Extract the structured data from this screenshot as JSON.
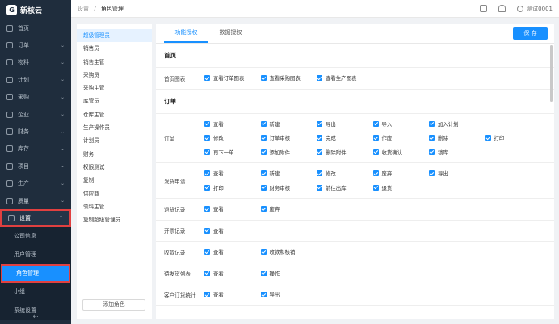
{
  "app": {
    "logo_glyph": "G",
    "name": "新核云"
  },
  "sidebar": {
    "items": [
      {
        "label": "首页",
        "icon": "home-icon",
        "has_chevron": false
      },
      {
        "label": "订单",
        "icon": "order-icon",
        "has_chevron": true
      },
      {
        "label": "物料",
        "icon": "material-icon",
        "has_chevron": true
      },
      {
        "label": "计划",
        "icon": "plan-icon",
        "has_chevron": true
      },
      {
        "label": "采购",
        "icon": "purchase-icon",
        "has_chevron": true
      },
      {
        "label": "企业",
        "icon": "company-icon",
        "has_chevron": true
      },
      {
        "label": "财务",
        "icon": "finance-icon",
        "has_chevron": true
      },
      {
        "label": "库存",
        "icon": "stock-icon",
        "has_chevron": true
      },
      {
        "label": "项目",
        "icon": "project-icon",
        "has_chevron": true
      },
      {
        "label": "生产",
        "icon": "production-icon",
        "has_chevron": true
      },
      {
        "label": "质量",
        "icon": "quality-icon",
        "has_chevron": true
      },
      {
        "label": "设置",
        "icon": "settings-icon",
        "has_chevron": true,
        "expanded": true
      }
    ],
    "submenu": [
      "公司信息",
      "用户管理",
      "角色管理",
      "小组",
      "系统设置"
    ],
    "active_sub": 2,
    "collapse_glyph": "⇠"
  },
  "header": {
    "breadcrumb_root": "设置",
    "breadcrumb_sep": "/",
    "breadcrumb_current": "角色管理",
    "user_name": "测试0001"
  },
  "roles": {
    "list": [
      "超级管理员",
      "销售员",
      "销售主管",
      "采购员",
      "采购主管",
      "库管员",
      "仓库主管",
      "生产操作员",
      "计划员",
      "财务",
      "权限测试",
      "复制",
      "供应商",
      "领料主管",
      "复制超级管理员"
    ],
    "selected": 0,
    "add_label": "添加角色"
  },
  "main": {
    "tabs": [
      "功能授权",
      "数据授权"
    ],
    "active_tab": 0,
    "save_label": "保 存",
    "sections": [
      {
        "title": "首页",
        "rows": [
          {
            "label": "首页图表",
            "lines": [
              [
                "查看订单图表",
                "查看采购图表",
                "查看生产图表"
              ]
            ]
          }
        ]
      },
      {
        "title": "订单",
        "rows": [
          {
            "label": "订单",
            "lines": [
              [
                "查看",
                "新建",
                "导出",
                "导入",
                "加入计划"
              ],
              [
                "修改",
                "订单审核",
                "完成",
                "作废",
                "删除",
                "打印"
              ],
              [
                "再下一单",
                "添加附件",
                "删除附件",
                "收货确认",
                "锁库"
              ]
            ]
          },
          {
            "label": "发货申请",
            "lines": [
              [
                "查看",
                "新建",
                "修改",
                "废弃",
                "导出"
              ],
              [
                "打印",
                "财务审核",
                "前往出库",
                "退货"
              ]
            ]
          },
          {
            "label": "退货记录",
            "lines": [
              [
                "查看",
                "废弃"
              ]
            ]
          },
          {
            "label": "开票记录",
            "lines": [
              [
                "查看"
              ]
            ]
          },
          {
            "label": "收款记录",
            "lines": [
              [
                "查看",
                "收款和核销"
              ]
            ]
          },
          {
            "label": "待发货列表",
            "lines": [
              [
                "查看",
                "操作"
              ]
            ]
          },
          {
            "label": "客户订货统计",
            "lines": [
              [
                "查看",
                "导出"
              ]
            ]
          }
        ]
      }
    ]
  }
}
